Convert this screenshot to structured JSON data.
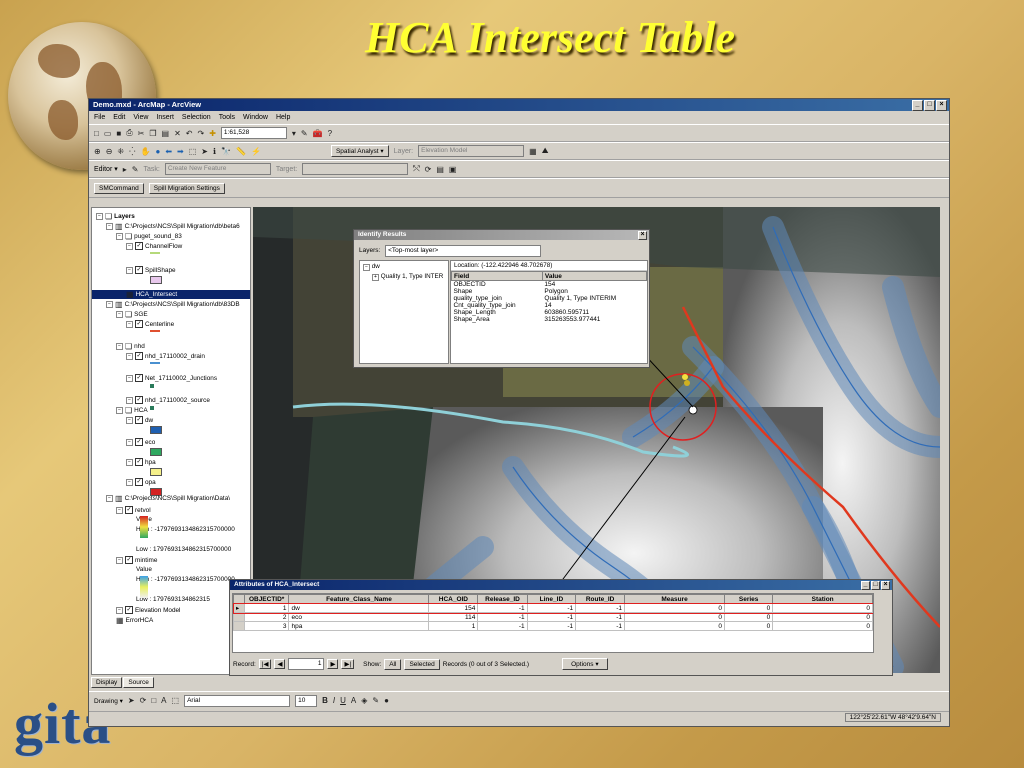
{
  "slide": {
    "title": "HCA Intersect Table",
    "logo_text": "gita"
  },
  "app": {
    "window_title": "Demo.mxd - ArcMap - ArcView",
    "menu": [
      "File",
      "Edit",
      "View",
      "Insert",
      "Selection",
      "Tools",
      "Window",
      "Help"
    ],
    "scale": "1:61,528",
    "spatial_analyst_label": "Spatial Analyst ▾",
    "layer_label": "Layer:",
    "layer_value": "Elevation Model",
    "editor_label": "Editor ▾",
    "task_label": "Task:",
    "task_value": "Create New Feature",
    "target_label": "Target:",
    "smcommand_label": "SMCommand",
    "spill_settings_label": "Spill Migration Settings",
    "toc_tabs": [
      "Display",
      "Source"
    ],
    "font_name": "Arial",
    "font_size": "10",
    "drawing_label": "Drawing ▾",
    "coordinates": "122°25'22.61\"W 48°42'9.64\"N"
  },
  "toc": {
    "rows": [
      {
        "text": "Layers",
        "indent": 0,
        "kind": "frame"
      },
      {
        "text": "C:\\Projects\\NCS\\Spill Migration\\db\\beta6",
        "indent": 1,
        "kind": "db"
      },
      {
        "text": "puget_sound_83",
        "indent": 2,
        "kind": "group"
      },
      {
        "text": "ChannelFlow",
        "indent": 3,
        "kind": "layer"
      },
      {
        "text": "SpillShape",
        "indent": 3,
        "kind": "layer"
      },
      {
        "text": "HCA_Intersect",
        "indent": 3,
        "kind": "table",
        "selected": true
      },
      {
        "text": "C:\\Projects\\NCS\\Spill Migration\\db\\83DB",
        "indent": 1,
        "kind": "db"
      },
      {
        "text": "SGE",
        "indent": 2,
        "kind": "group"
      },
      {
        "text": "Centerline",
        "indent": 3,
        "kind": "layer"
      },
      {
        "text": "nhd",
        "indent": 2,
        "kind": "group"
      },
      {
        "text": "nhd_17110002_drain",
        "indent": 3,
        "kind": "layer"
      },
      {
        "text": "Net_17110002_Junctions",
        "indent": 3,
        "kind": "layer"
      },
      {
        "text": "nhd_17110002_source",
        "indent": 3,
        "kind": "layer"
      },
      {
        "text": "HCA",
        "indent": 2,
        "kind": "group"
      },
      {
        "text": "dw",
        "indent": 3,
        "kind": "layer"
      },
      {
        "text": "eco",
        "indent": 3,
        "kind": "layer"
      },
      {
        "text": "hpa",
        "indent": 3,
        "kind": "layer"
      },
      {
        "text": "opa",
        "indent": 3,
        "kind": "layer"
      },
      {
        "text": "C:\\Projects\\NCS\\Spill Migration\\Data\\",
        "indent": 1,
        "kind": "db"
      },
      {
        "text": "retvol",
        "indent": 2,
        "kind": "layer"
      },
      {
        "text": "Value",
        "indent": 4,
        "kind": "text"
      },
      {
        "text": "High : -1797693134862315700000",
        "indent": 4,
        "kind": "text"
      },
      {
        "text": "Low : 1797693134862315700000",
        "indent": 4,
        "kind": "text"
      },
      {
        "text": "mintime",
        "indent": 2,
        "kind": "layer"
      },
      {
        "text": "Value",
        "indent": 4,
        "kind": "text"
      },
      {
        "text": "High : -1797693134862315700000",
        "indent": 4,
        "kind": "text"
      },
      {
        "text": "Low : 1797693134862315",
        "indent": 4,
        "kind": "text"
      },
      {
        "text": "Elevation Model",
        "indent": 2,
        "kind": "layer"
      },
      {
        "text": "ErrorHCA",
        "indent": 2,
        "kind": "table"
      }
    ],
    "colors": {
      "channelflow": "#b5d97a",
      "spillshape": "#e8c8ec",
      "centerline": "#e05030",
      "drain": "#4a90d0",
      "junction": "#2a7a5a",
      "source": "#2a7a5a",
      "dw": "#1f5fb0",
      "eco": "#2fa860",
      "hpa": "#f5f08a",
      "opa": "#d42020"
    }
  },
  "identify": {
    "title": "Identify Results",
    "layers_label": "Layers:",
    "layers_value": "<Top-most layer>",
    "tree": [
      "dw",
      "Quality 1, Type INTER"
    ],
    "location": "Location: (-122.422946 48.702678)",
    "headers": [
      "Field",
      "Value"
    ],
    "rows": [
      [
        "OBJECTID",
        "154"
      ],
      [
        "Shape",
        "Polygon"
      ],
      [
        "quality_type_join",
        "Quality 1, Type INTERIM"
      ],
      [
        "Cnt_quality_type_join",
        "14"
      ],
      [
        "Shape_Length",
        "603860.595711"
      ],
      [
        "Shape_Area",
        "315263553.977441"
      ]
    ]
  },
  "attributes": {
    "title": "Attributes of HCA_Intersect",
    "columns": [
      "OBJECTID*",
      "Feature_Class_Name",
      "HCA_OID",
      "Release_ID",
      "Line_ID",
      "Route_ID",
      "Measure",
      "Series",
      "Station"
    ],
    "rows": [
      [
        "1",
        "dw",
        "154",
        "-1",
        "-1",
        "-1",
        "0",
        "0",
        "0"
      ],
      [
        "2",
        "eco",
        "114",
        "-1",
        "-1",
        "-1",
        "0",
        "0",
        "0"
      ],
      [
        "3",
        "hpa",
        "1",
        "-1",
        "-1",
        "-1",
        "0",
        "0",
        "0"
      ]
    ],
    "record_label": "Record:",
    "record_value": "1",
    "show_label": "Show:",
    "show_all": "All",
    "show_selected": "Selected",
    "records_text": "Records (0 out of 3 Selected.)",
    "options_label": "Options ▾"
  },
  "toolbar_icons": [
    "new-icon",
    "open-icon",
    "save-icon",
    "print-icon",
    "cut-icon",
    "copy-icon",
    "paste-icon",
    "delete-icon",
    "undo-icon",
    "redo-icon",
    "add-data-icon"
  ]
}
